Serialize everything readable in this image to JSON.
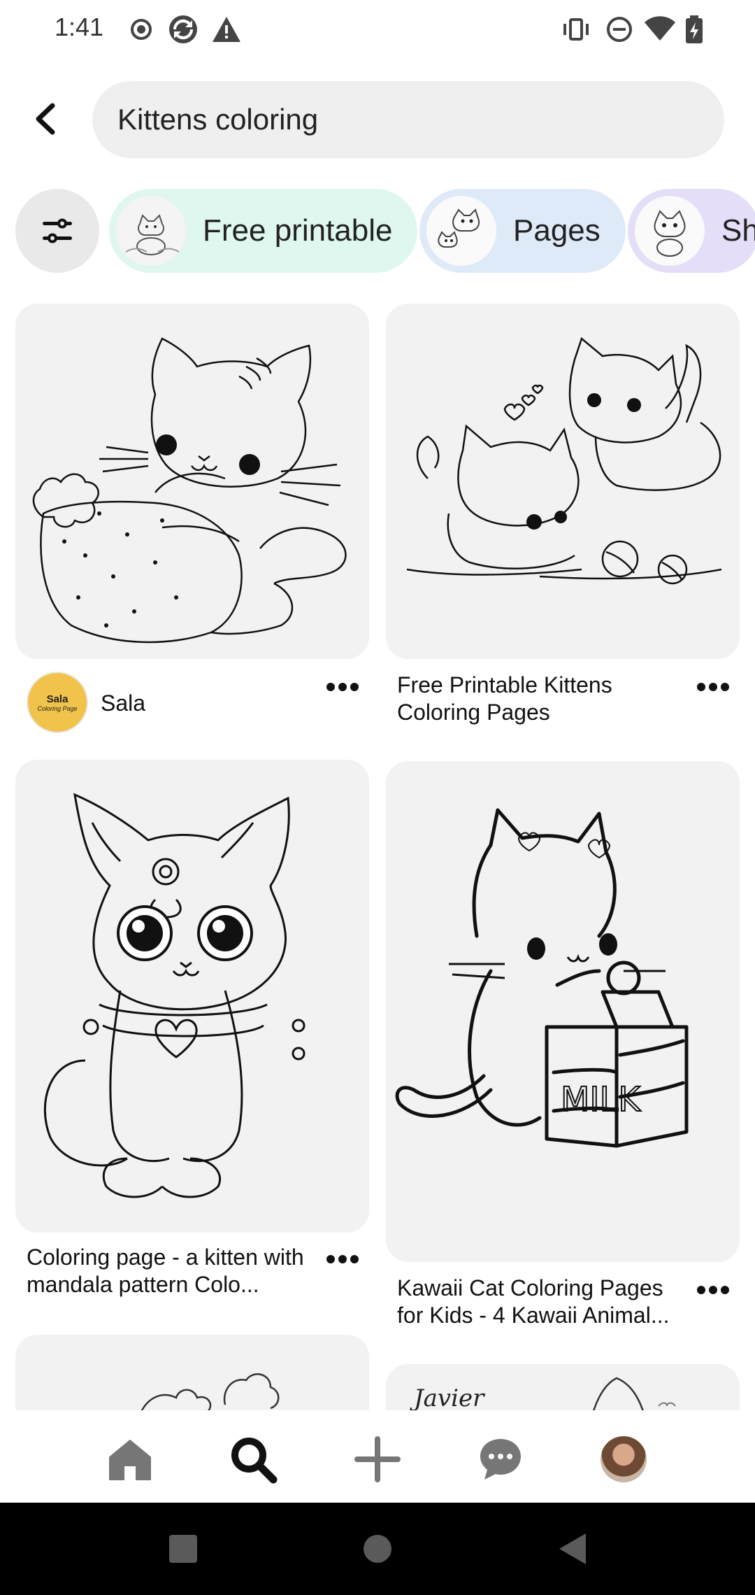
{
  "status_bar": {
    "time": "1:41",
    "left_icons": [
      "record-icon",
      "sync-icon",
      "warning-icon"
    ],
    "right_icons": [
      "vibrate-icon",
      "do-not-disturb-icon",
      "wifi-icon",
      "battery-charging-icon"
    ]
  },
  "search": {
    "query": "Kittens coloring"
  },
  "chips": [
    {
      "label": "Free printable",
      "color": "#dff7ee"
    },
    {
      "label": "Pages",
      "color": "#dfeaf8"
    },
    {
      "label": "Sh",
      "color": "#e4def8"
    }
  ],
  "pins": [
    {
      "title": "",
      "author": "Sala",
      "avatar_text_1": "Sala",
      "avatar_text_2": "Coloring Page"
    },
    {
      "title": "Free Printable Kittens Coloring Pages"
    },
    {
      "title": "Coloring page - a kitten with mandala pattern Colo..."
    },
    {
      "title": "Kawaii Cat Coloring Pages for Kids - 4 Kawaii Animal..."
    }
  ],
  "partial_pin_text": "Javier Origin",
  "bottom_nav": [
    "home-icon",
    "search-icon",
    "create-icon",
    "messages-icon",
    "profile-avatar"
  ],
  "colors": {
    "card_bg": "#f2f2f2",
    "search_bg": "#efefef",
    "nav_active": "#111111",
    "nav_inactive": "#767676"
  }
}
